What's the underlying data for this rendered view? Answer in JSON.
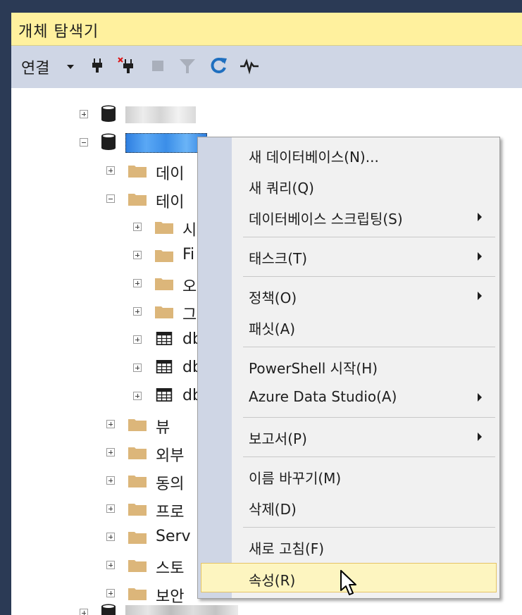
{
  "panel": {
    "title": "개체 탐색기"
  },
  "toolbar": {
    "connect_label": "연결",
    "icons": [
      "connect-plug-icon",
      "disconnect-plug-icon",
      "stop-icon",
      "filter-icon",
      "refresh-icon",
      "activity-monitor-icon"
    ]
  },
  "tree": {
    "items": [
      {
        "label": "데이",
        "kind": "folder"
      },
      {
        "label": "테이",
        "kind": "folder"
      },
      {
        "label": "시",
        "kind": "folder"
      },
      {
        "label": "Fi",
        "kind": "folder"
      },
      {
        "label": "오",
        "kind": "folder"
      },
      {
        "label": "그",
        "kind": "folder"
      },
      {
        "label": "db",
        "kind": "table"
      },
      {
        "label": "db",
        "kind": "table"
      },
      {
        "label": "db",
        "kind": "table"
      },
      {
        "label": "뷰",
        "kind": "folder"
      },
      {
        "label": "외부",
        "kind": "folder"
      },
      {
        "label": "동의",
        "kind": "folder"
      },
      {
        "label": "프로",
        "kind": "folder"
      },
      {
        "label": "Serv",
        "kind": "folder"
      },
      {
        "label": "스토",
        "kind": "folder"
      },
      {
        "label": "보안",
        "kind": "folder"
      }
    ]
  },
  "context_menu": {
    "items": [
      {
        "label": "새 데이터베이스(N)..."
      },
      {
        "label": "새 쿼리(Q)"
      },
      {
        "label": "데이터베이스 스크립팅(S)"
      },
      {
        "label": "태스크(T)"
      },
      {
        "label": "정책(O)"
      },
      {
        "label": "패싯(A)"
      },
      {
        "label": "PowerShell 시작(H)"
      },
      {
        "label": "Azure Data Studio(A)"
      },
      {
        "label": "보고서(P)"
      },
      {
        "label": "이름 바꾸기(M)"
      },
      {
        "label": "삭제(D)"
      },
      {
        "label": "새로 고침(F)"
      },
      {
        "label": "속성(R)"
      }
    ],
    "highlighted": "속성(R)"
  },
  "colors": {
    "title_bg": "#fff19e",
    "toolbar_bg": "#cfd6e5",
    "selection_blue": "#3b8ee8",
    "highlight_bg": "#fdf5c0",
    "folder": "#dcb67a"
  }
}
